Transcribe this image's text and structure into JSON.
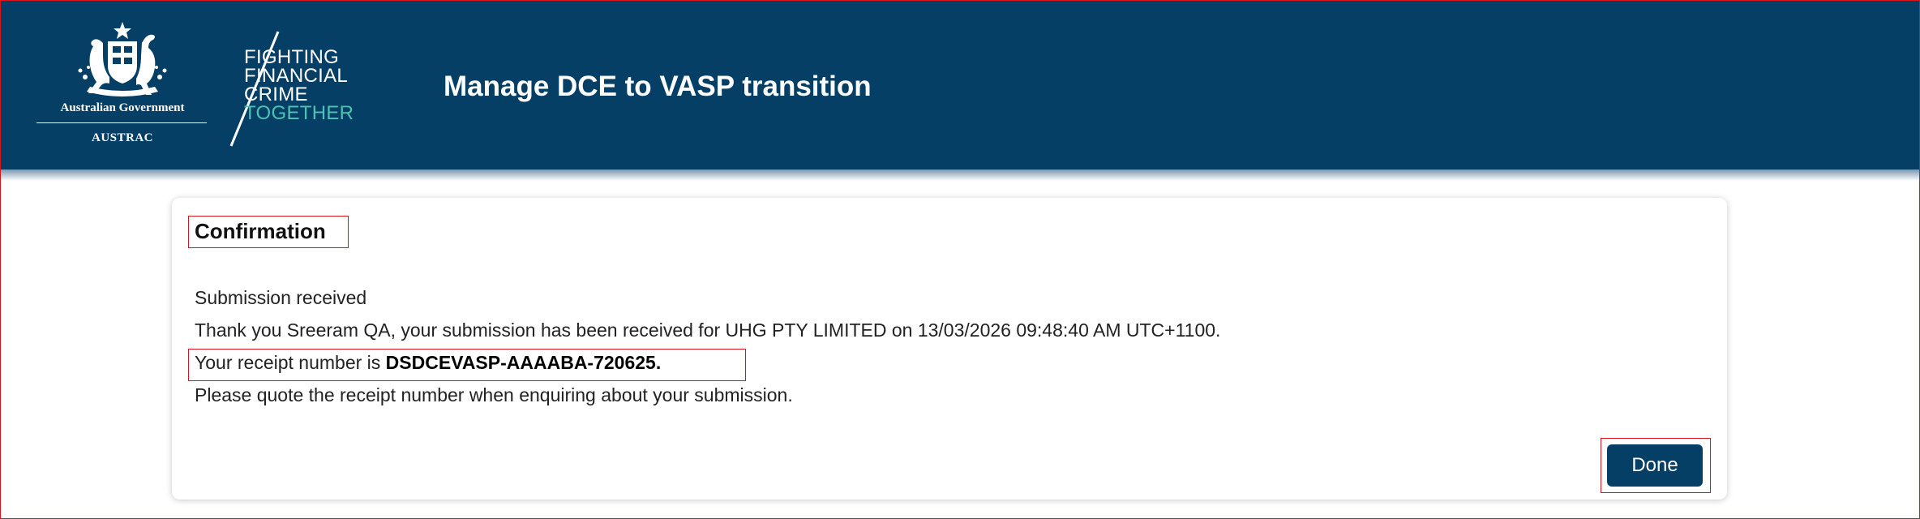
{
  "header": {
    "government_name": "Australian Government",
    "agency": "AUSTRAC",
    "tagline": [
      "FIGHTING",
      "FINANCIAL",
      "CRIME",
      "TOGETHER"
    ],
    "app_title": "Manage DCE to VASP transition"
  },
  "confirmation": {
    "title": "Confirmation",
    "status": "Submission received",
    "thank_you": "Thank you Sreeram QA, your submission has been received for UHG PTY LIMITED on 13/03/2026 09:48:40 AM UTC+1100.",
    "receipt_prefix": "Your receipt number is ",
    "receipt_number": "DSDCEVASP-AAAABA-720625.",
    "quote_note": "Please quote the receipt number when enquiring about your submission.",
    "done_label": "Done"
  },
  "colors": {
    "header_bg": "#053f66",
    "accent_teal": "#4cc3b4",
    "highlight_border": "#d9141b"
  }
}
